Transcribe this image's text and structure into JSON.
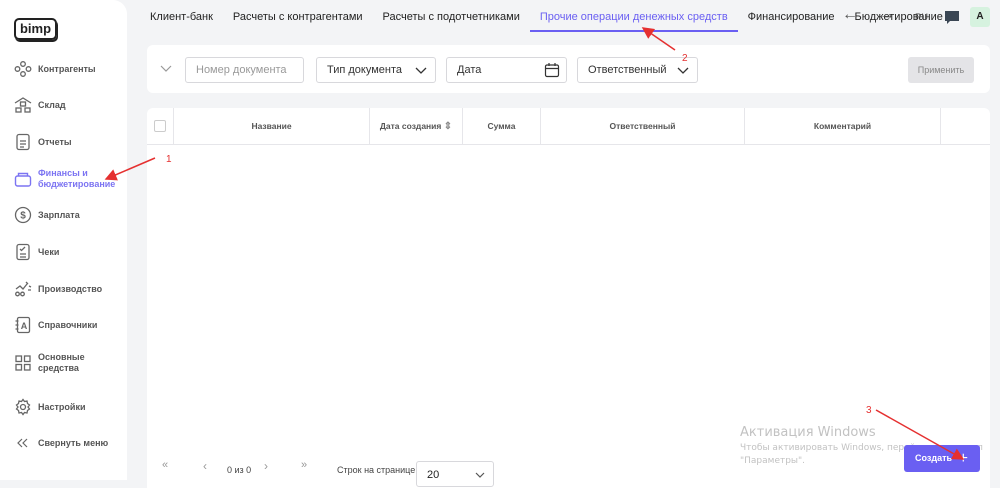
{
  "logo": "bimp",
  "sidebar": {
    "items": [
      {
        "label": "Контрагенты",
        "icon": "nodes-icon"
      },
      {
        "label": "Склад",
        "icon": "warehouse-icon"
      },
      {
        "label": "Отчеты",
        "icon": "document-icon"
      },
      {
        "label": "Финансы и бюджетирование",
        "icon": "wallet-icon",
        "active": true
      },
      {
        "label": "Зарплата",
        "icon": "dollar-icon"
      },
      {
        "label": "Чеки",
        "icon": "receipt-icon"
      },
      {
        "label": "Производство",
        "icon": "production-icon"
      },
      {
        "label": "Справочники",
        "icon": "directory-icon"
      },
      {
        "label": "Основные средства",
        "icon": "grid-icon"
      },
      {
        "label": "Настройки",
        "icon": "gear-icon"
      },
      {
        "label": "Свернуть меню",
        "icon": "double-chevron-left-icon"
      }
    ]
  },
  "tabs": [
    "Клиент-банк",
    "Расчеты с контрагентами",
    "Расчеты с подотчетниками",
    "Прочие операции денежных средств",
    "Финансирование",
    "Бюджетирование"
  ],
  "active_tab": 3,
  "header": {
    "lang": "RU",
    "avatar": "A"
  },
  "filters": {
    "doc_number_placeholder": "Номер документа",
    "doc_type": "Тип документа",
    "date": "Дата",
    "responsible": "Ответственный",
    "apply": "Применить"
  },
  "table": {
    "columns": [
      "Название",
      "Дата создания",
      "Сумма",
      "Ответственный",
      "Комментарий"
    ],
    "rows": []
  },
  "pagination": {
    "info": "0 из 0",
    "rows_label": "Строк на странице",
    "rows_value": "20"
  },
  "create_button": "Создать",
  "annotations": [
    "1",
    "2",
    "3"
  ],
  "watermark": {
    "title": "Активация Windows",
    "line1": "Чтобы активировать Windows, перейдите в раздел",
    "line2": "\"Параметры\"."
  },
  "colors": {
    "accent": "#6a5ff2",
    "annotation": "#e53030"
  }
}
